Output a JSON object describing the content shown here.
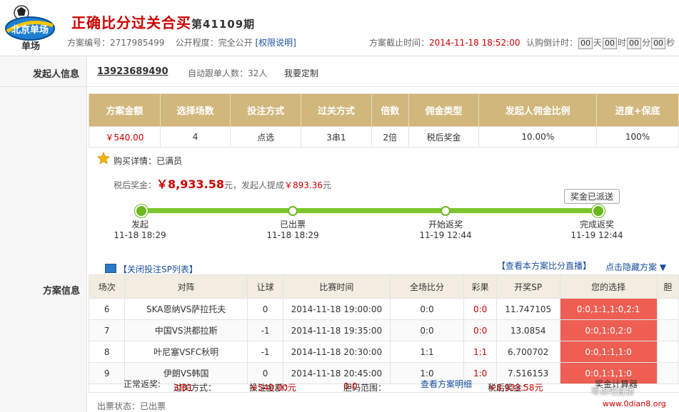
{
  "header": {
    "logo_text": "单场",
    "title": "正确比分过关合买",
    "issue": "第41109期",
    "plan_no_label": "方案编号：",
    "plan_no": "2717985499",
    "public_label": "公开程度：",
    "public_value": "完全公开",
    "perm_link": "[权限说明]",
    "deadline_label": "方案截止时间：",
    "deadline": "2014-11-18 18:52:00",
    "countdown_label": "认购倒计时：",
    "countdown": {
      "d": "00",
      "d_unit": "天",
      "h": "00",
      "h_unit": "时",
      "m": "00",
      "m_unit": "分",
      "s": "00",
      "s_unit": "秒"
    }
  },
  "sponsor": {
    "label": "发起人信息",
    "phone": "13923689490",
    "follow": "自动跟单人数：32人",
    "custom": "我要定制"
  },
  "summary": {
    "headers": [
      "方案金额",
      "选择场数",
      "投注方式",
      "过关方式",
      "倍数",
      "佣金类型",
      "发起人佣金比例",
      "进度+保底"
    ],
    "values": [
      "￥540.00",
      "4",
      "点选",
      "3串1",
      "2倍",
      "税后奖金",
      "10.00%",
      "100%"
    ]
  },
  "buy_info": "购买详情：已满员",
  "bonus": {
    "label": "税后奖金：",
    "amount": "￥8,933.58",
    "unit": "元，发起人提成",
    "commission": "￥893.36",
    "tail": "元"
  },
  "dispatched": "奖金已派送",
  "progress_steps": [
    {
      "label": "发起",
      "time": "11-18 18:29"
    },
    {
      "label": "已出票",
      "time": "11-18 18:29"
    },
    {
      "label": "开始返奖",
      "time": "11-19 12:44"
    },
    {
      "label": "完成返奖",
      "time": "11-19 12:44"
    }
  ],
  "plan_label": "方案信息",
  "toggle_sp": "【关闭投注SP列表】",
  "live_link": "【查看本方案比分直播】",
  "hide_plan": "点击隐藏方案 ▼",
  "matches": {
    "headers": [
      "场次",
      "对阵",
      "让球",
      "比赛时间",
      "全场比分",
      "彩果",
      "开奖SP",
      "您的选择",
      "胆"
    ],
    "rows": [
      [
        "6",
        "SKA恩纳VS萨拉托夫",
        "0",
        "2014-11-18 19:00:00",
        "0:0",
        "0:0",
        "11.747105",
        "0:0,1:1,1:0,2:1",
        ""
      ],
      [
        "7",
        "中国VS洪都拉斯",
        "-1",
        "2014-11-18 19:35:00",
        "0:0",
        "0:0",
        "13.0854",
        "0:0,1:0,2:0",
        ""
      ],
      [
        "8",
        "叶尼塞VSFC秋明",
        "-1",
        "2014-11-18 20:30:00",
        "1:1",
        "1:1",
        "6.700702",
        "0:0,1:1,1:0",
        ""
      ],
      [
        "9",
        "伊朗VS韩国",
        "0",
        "2014-11-18 20:45:00",
        "1:0",
        "1:0",
        "7.516153",
        "0:0,1:1,1:0",
        ""
      ]
    ]
  },
  "footer": {
    "normal": "正常返奖:",
    "pass_label": "过关方式：",
    "pass": "3串1",
    "amount_label": "投注金额：",
    "amount": "￥540.00元",
    "range_label": "胆码范围：",
    "range": "0-0",
    "detail_link": "查看方案明细",
    "bonus_label": "税后奖金：",
    "bonus": "￥8,933.58元",
    "calc": "奖金计算器"
  },
  "ticket_status": "出票状态：已出票",
  "watermark": "零点吧直播",
  "watermark_url": "www.0dian8.org"
}
